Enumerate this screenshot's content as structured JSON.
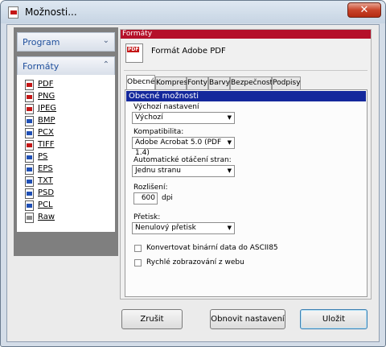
{
  "window": {
    "title": "Možnosti..."
  },
  "sidebar": {
    "program_label": "Program",
    "formats_label": "Formáty",
    "formats": [
      {
        "label": "PDF",
        "color": "#c41616"
      },
      {
        "label": "PNG",
        "color": "#c41616"
      },
      {
        "label": "JPEG",
        "color": "#c41616"
      },
      {
        "label": "BMP",
        "color": "#1f4fb5"
      },
      {
        "label": "PCX",
        "color": "#1f4fb5"
      },
      {
        "label": "TIFF",
        "color": "#c41616"
      },
      {
        "label": "PS",
        "color": "#1f4fb5"
      },
      {
        "label": "EPS",
        "color": "#1f4fb5"
      },
      {
        "label": "TXT",
        "color": "#1f4fb5"
      },
      {
        "label": "PSD",
        "color": "#1f4fb5"
      },
      {
        "label": "PCL",
        "color": "#1f4fb5"
      },
      {
        "label": "Raw",
        "color": "#8a8a8a"
      }
    ]
  },
  "panel": {
    "header": "Formáty",
    "title": "Formát Adobe PDF",
    "tabs": [
      "Obecné",
      "Komprese",
      "Fonty",
      "Barvy",
      "Bezpečnost",
      "Podpisy"
    ],
    "section": "Obecné možnosti",
    "fields": {
      "default_label": "Výchozí nastavení",
      "default_value": "Výchozí",
      "compat_label": "Kompatibilita:",
      "compat_value": "Adobe Acrobat 5.0 (PDF 1.4)",
      "rotate_label": "Automatické otáčení stran:",
      "rotate_value": "Jednu stranu",
      "resolution_label": "Rozlišení:",
      "resolution_value": "600",
      "resolution_unit": "dpi",
      "overprint_label": "Přetisk:",
      "overprint_value": "Nenulový přetisk",
      "ascii_label": "Konvertovat binární data do ASCII85",
      "web_label": "Rychlé zobrazování z webu"
    }
  },
  "buttons": {
    "cancel": "Zrušit",
    "reset": "Obnovit nastavení",
    "save": "Uložit"
  }
}
